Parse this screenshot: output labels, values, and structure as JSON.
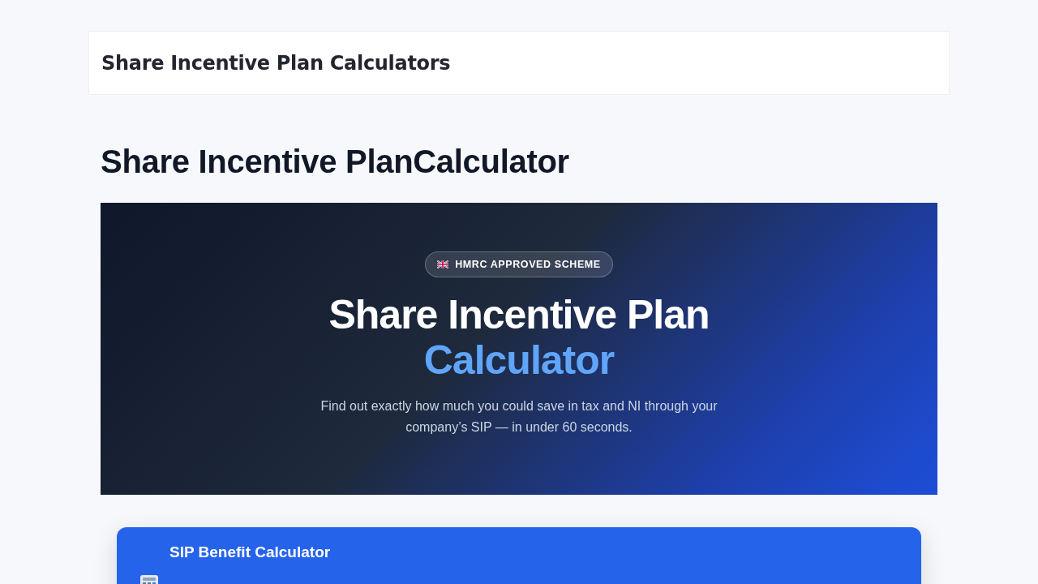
{
  "header": {
    "title": "Share Incentive Plan Calculators"
  },
  "page": {
    "heading": "Share Incentive PlanCalculator"
  },
  "hero": {
    "badge": "HMRC APPROVED SCHEME",
    "title": "Share Incentive Plan",
    "title_highlight": "Calculator",
    "subtitle": "Find out exactly how much you could save in tax and NI through your company’s SIP — in under 60 seconds."
  },
  "calculator": {
    "title": "SIP Benefit Calculator"
  }
}
